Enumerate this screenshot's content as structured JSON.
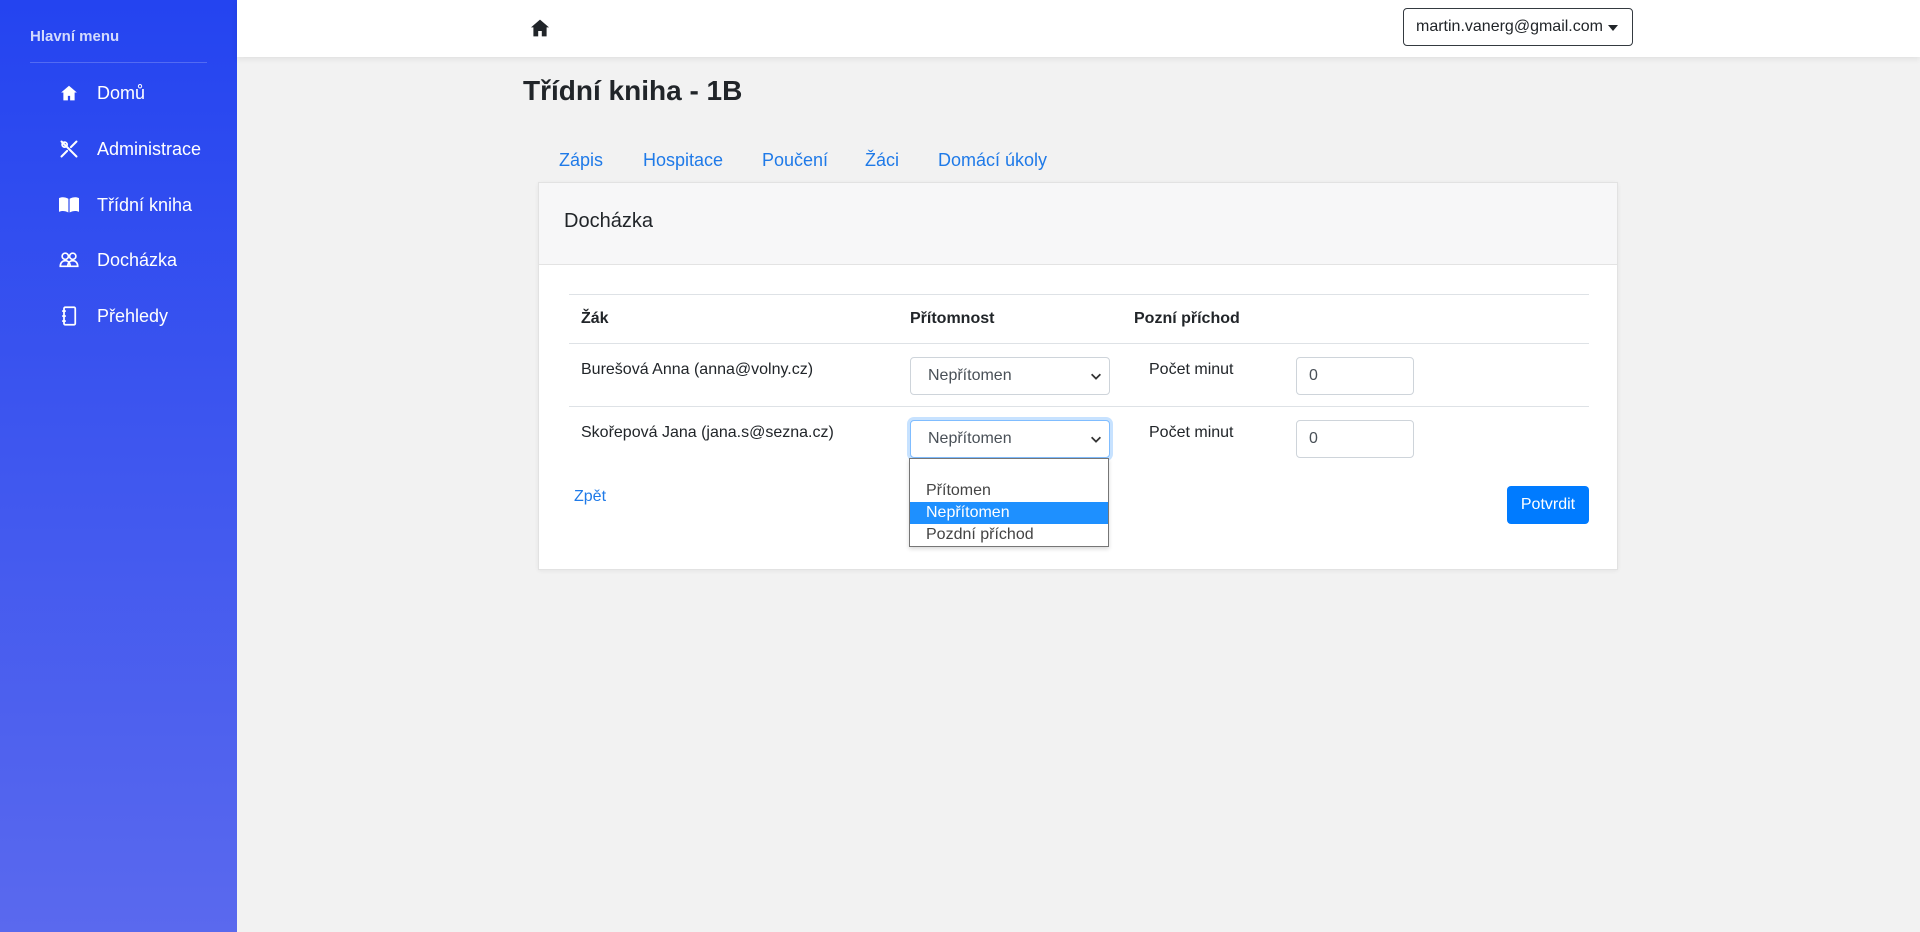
{
  "sidebar": {
    "heading": "Hlavní menu",
    "items": [
      {
        "label": "Domů",
        "icon": "home-icon"
      },
      {
        "label": "Administrace",
        "icon": "tools-icon"
      },
      {
        "label": "Třídní kniha",
        "icon": "book-icon"
      },
      {
        "label": "Docházka",
        "icon": "people-icon"
      },
      {
        "label": "Přehledy",
        "icon": "journal-icon"
      }
    ]
  },
  "header": {
    "user_email": "martin.vanerg@gmail.com"
  },
  "page": {
    "title": "Třídní kniha - 1B"
  },
  "tabs": [
    {
      "label": "Zápis"
    },
    {
      "label": "Hospitace"
    },
    {
      "label": "Poučení"
    },
    {
      "label": "Žáci"
    },
    {
      "label": "Domácí úkoly"
    }
  ],
  "card": {
    "title": "Docházka",
    "columns": [
      "Žák",
      "Přítomnost",
      "Pozní příchod"
    ],
    "rows": [
      {
        "student": "Burešová Anna (anna@volny.cz)",
        "presence": "Nepřítomen",
        "minutes_label": "Počet minut",
        "minutes": "0"
      },
      {
        "student": "Skořepová Jana (jana.s@sezna.cz)",
        "presence": "Nepřítomen",
        "minutes_label": "Počet minut",
        "minutes": "0"
      }
    ],
    "back_label": "Zpět",
    "confirm_label": "Potvrdit"
  },
  "dropdown": {
    "options": [
      "Přítomen",
      "Nepřítomen",
      "Pozdní příchod"
    ],
    "selected": "Nepřítomen"
  },
  "colors": {
    "sidebar_top": "#2444f0",
    "sidebar_bottom": "#5a69ee",
    "link": "#1f7ae8",
    "primary": "#007bff",
    "option_highlight": "#1e90ff"
  }
}
